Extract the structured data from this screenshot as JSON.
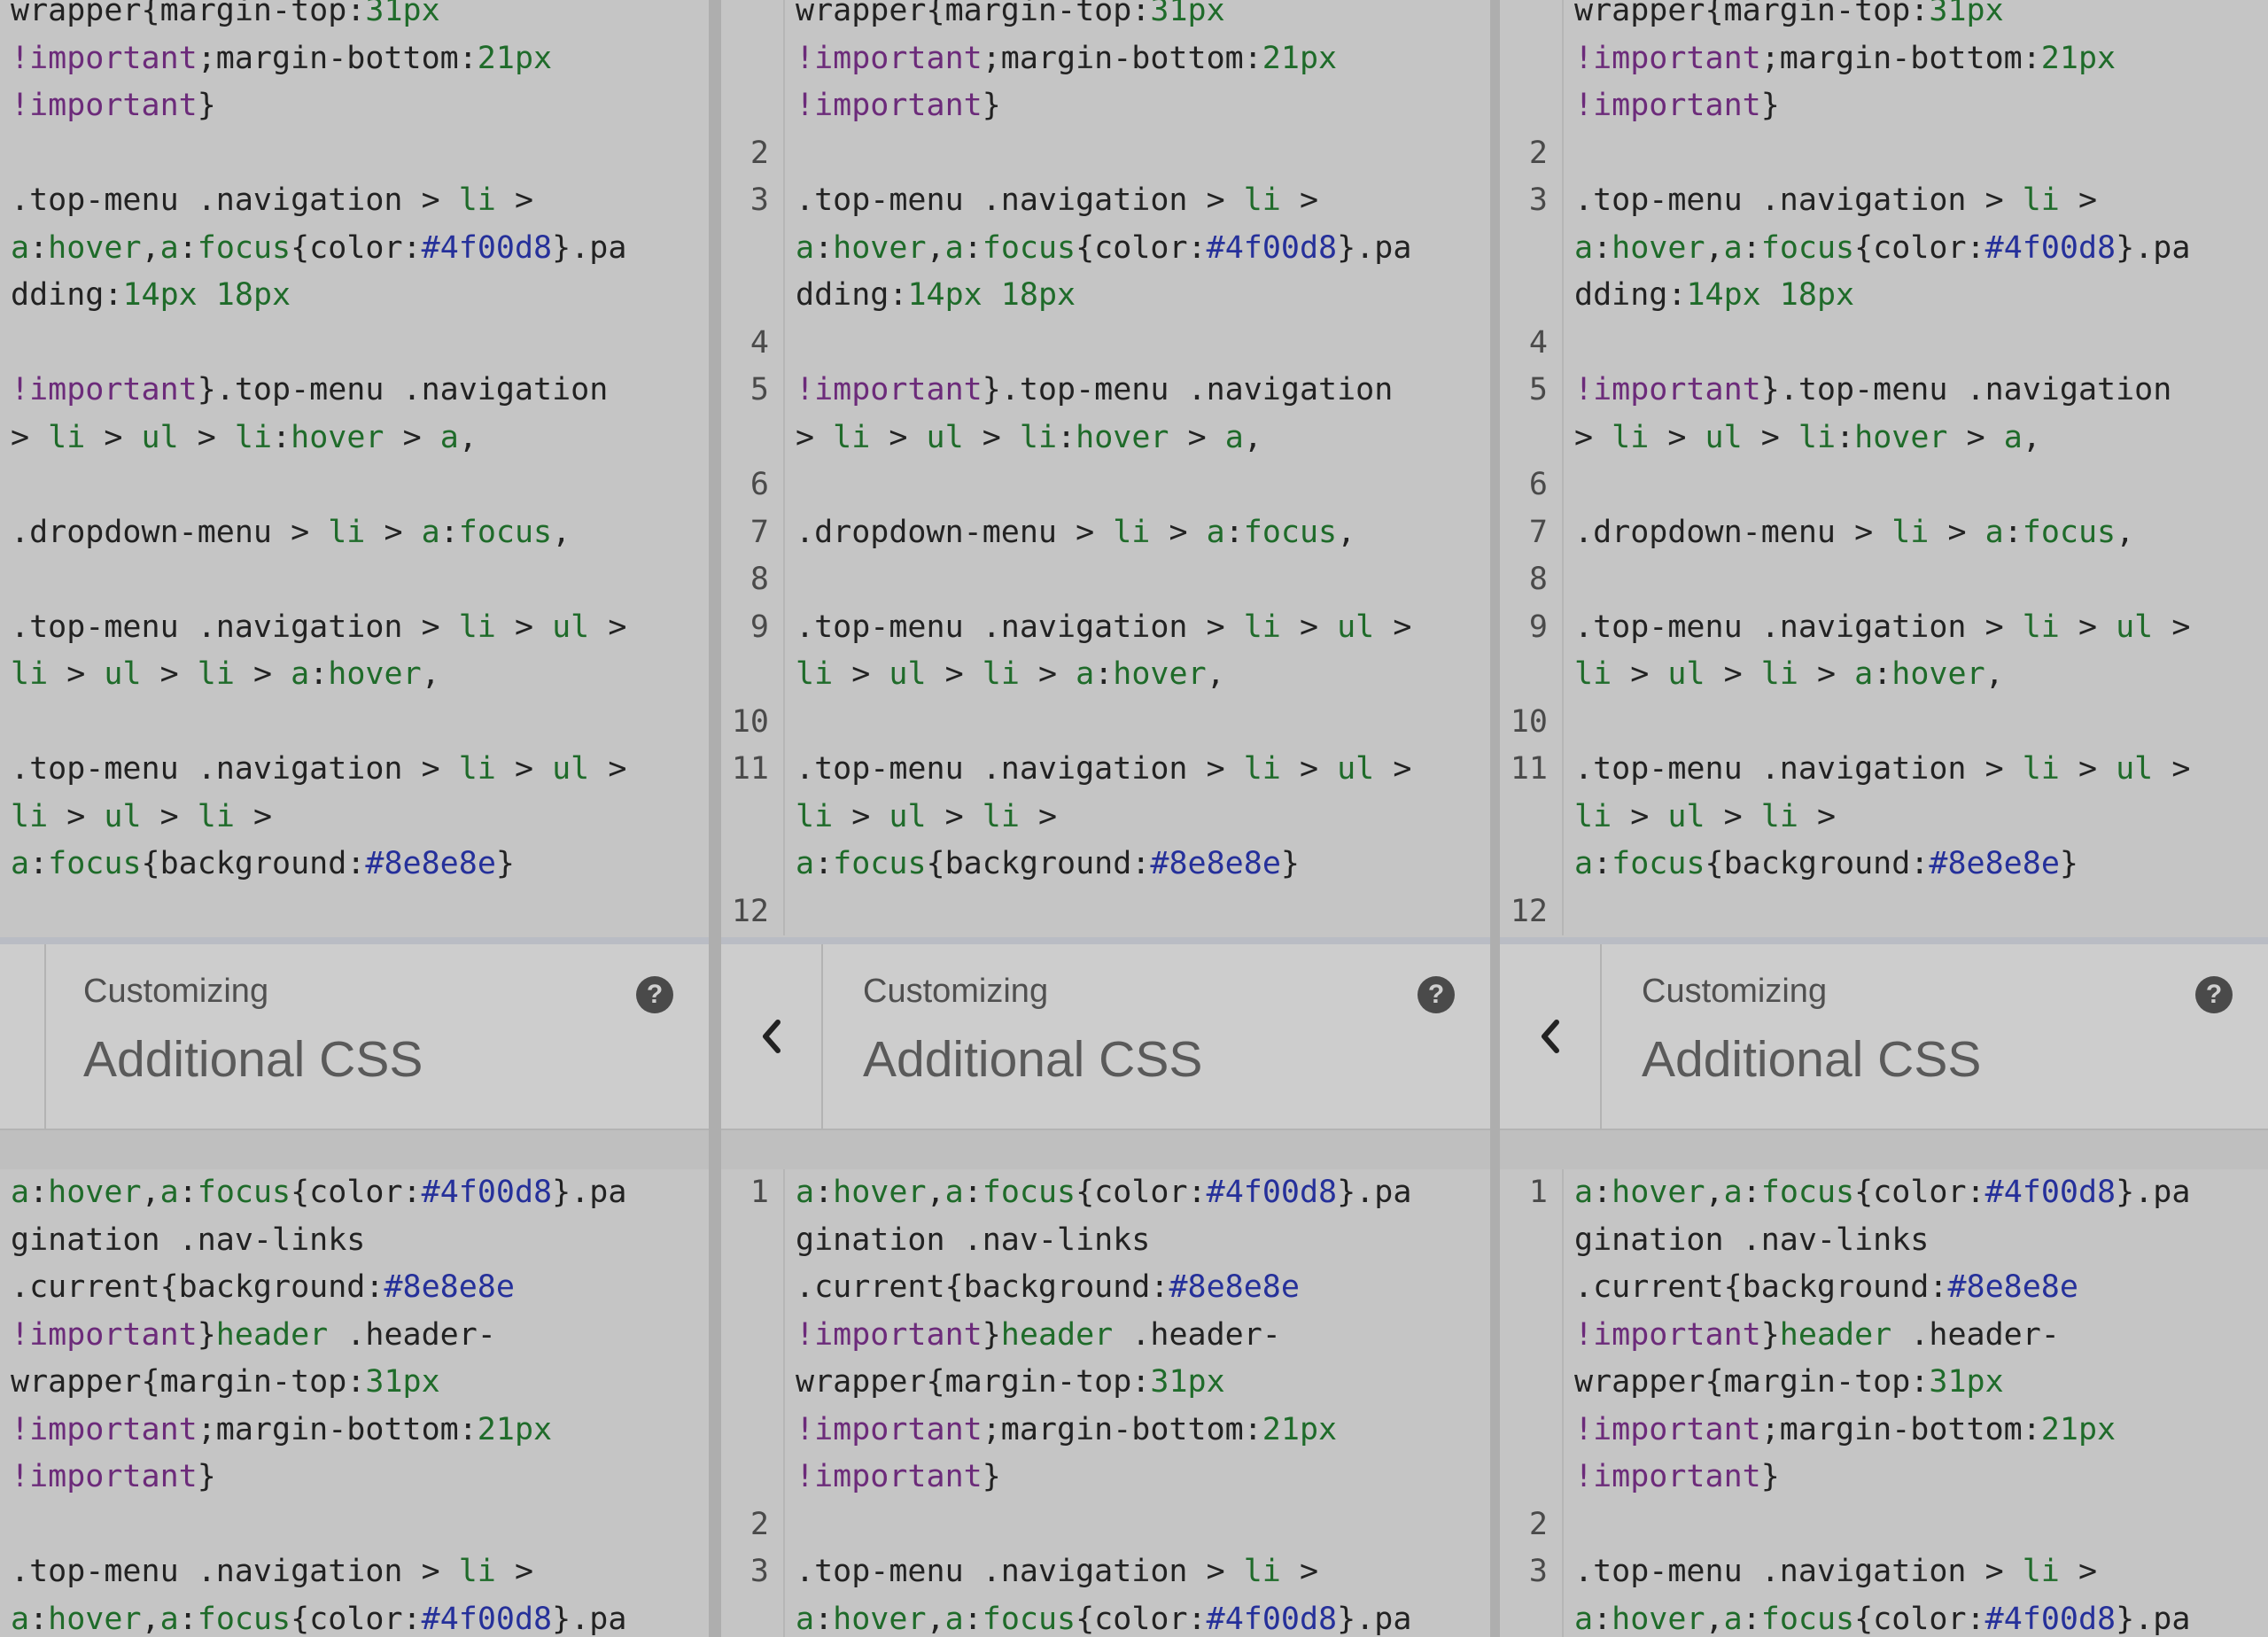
{
  "header": {
    "subtitle": "Customizing",
    "title": "Additional CSS",
    "help_glyph": "?",
    "back_icon": "chevron-left-icon",
    "help_icon": "question-circle-icon"
  },
  "code_top": {
    "lines": [
      {
        "num": "",
        "tokens": [
          [
            "t",
            "wrapper{margin-top:"
          ],
          [
            "n",
            "31px"
          ]
        ]
      },
      {
        "num": "",
        "tokens": [
          [
            "k",
            "!important"
          ],
          [
            "t",
            ";margin-bottom:"
          ],
          [
            "n",
            "21px"
          ]
        ]
      },
      {
        "num": "",
        "tokens": [
          [
            "k",
            "!important"
          ],
          [
            "t",
            "}"
          ]
        ]
      },
      {
        "num": "2",
        "tokens": []
      },
      {
        "num": "3",
        "tokens": [
          [
            "t",
            ".top-menu .navigation > "
          ],
          [
            "g",
            "li"
          ],
          [
            "t",
            " >"
          ]
        ]
      },
      {
        "num": "",
        "tokens": [
          [
            "g",
            "a"
          ],
          [
            "t",
            ":"
          ],
          [
            "g",
            "hover"
          ],
          [
            "t",
            ","
          ],
          [
            "g",
            "a"
          ],
          [
            "t",
            ":"
          ],
          [
            "g",
            "focus"
          ],
          [
            "t",
            "{color:"
          ],
          [
            "h",
            "#4f00d8"
          ],
          [
            "t",
            "}.pa"
          ]
        ]
      },
      {
        "num": "",
        "tokens": [
          [
            "t",
            "dding:"
          ],
          [
            "n",
            "14px 18px"
          ]
        ]
      },
      {
        "num": "4",
        "tokens": []
      },
      {
        "num": "5",
        "tokens": [
          [
            "k",
            "!important"
          ],
          [
            "t",
            "}.top-menu .navigation"
          ]
        ]
      },
      {
        "num": "",
        "tokens": [
          [
            "t",
            "> "
          ],
          [
            "g",
            "li"
          ],
          [
            "t",
            " > "
          ],
          [
            "g",
            "ul"
          ],
          [
            "t",
            " > "
          ],
          [
            "g",
            "li"
          ],
          [
            "t",
            ":"
          ],
          [
            "g",
            "hover"
          ],
          [
            "t",
            " > "
          ],
          [
            "g",
            "a"
          ],
          [
            "t",
            ","
          ]
        ]
      },
      {
        "num": "6",
        "tokens": []
      },
      {
        "num": "7",
        "tokens": [
          [
            "t",
            ".dropdown-menu > "
          ],
          [
            "g",
            "li"
          ],
          [
            "t",
            " > "
          ],
          [
            "g",
            "a"
          ],
          [
            "t",
            ":"
          ],
          [
            "g",
            "focus"
          ],
          [
            "t",
            ","
          ]
        ]
      },
      {
        "num": "8",
        "tokens": []
      },
      {
        "num": "9",
        "tokens": [
          [
            "t",
            ".top-menu .navigation > "
          ],
          [
            "g",
            "li"
          ],
          [
            "t",
            " > "
          ],
          [
            "g",
            "ul"
          ],
          [
            "t",
            " >"
          ]
        ]
      },
      {
        "num": "",
        "tokens": [
          [
            "g",
            "li"
          ],
          [
            "t",
            " > "
          ],
          [
            "g",
            "ul"
          ],
          [
            "t",
            " > "
          ],
          [
            "g",
            "li"
          ],
          [
            "t",
            " > "
          ],
          [
            "g",
            "a"
          ],
          [
            "t",
            ":"
          ],
          [
            "g",
            "hover"
          ],
          [
            "t",
            ","
          ]
        ]
      },
      {
        "num": "10",
        "tokens": []
      },
      {
        "num": "11",
        "tokens": [
          [
            "t",
            ".top-menu .navigation > "
          ],
          [
            "g",
            "li"
          ],
          [
            "t",
            " > "
          ],
          [
            "g",
            "ul"
          ],
          [
            "t",
            " >"
          ]
        ]
      },
      {
        "num": "",
        "tokens": [
          [
            "g",
            "li"
          ],
          [
            "t",
            " > "
          ],
          [
            "g",
            "ul"
          ],
          [
            "t",
            " > "
          ],
          [
            "g",
            "li"
          ],
          [
            "t",
            " >"
          ]
        ]
      },
      {
        "num": "",
        "tokens": [
          [
            "g",
            "a"
          ],
          [
            "t",
            ":"
          ],
          [
            "g",
            "focus"
          ],
          [
            "t",
            "{background:"
          ],
          [
            "h",
            "#8e8e8e"
          ],
          [
            "t",
            "}"
          ]
        ]
      },
      {
        "num": "12",
        "tokens": []
      }
    ]
  },
  "code_bottom": {
    "lines": [
      {
        "num": "1",
        "tokens": [
          [
            "g",
            "a"
          ],
          [
            "t",
            ":"
          ],
          [
            "g",
            "hover"
          ],
          [
            "t",
            ","
          ],
          [
            "g",
            "a"
          ],
          [
            "t",
            ":"
          ],
          [
            "g",
            "focus"
          ],
          [
            "t",
            "{color:"
          ],
          [
            "h",
            "#4f00d8"
          ],
          [
            "t",
            "}.pa"
          ]
        ]
      },
      {
        "num": "",
        "tokens": [
          [
            "t",
            "gination .nav-links"
          ]
        ]
      },
      {
        "num": "",
        "tokens": [
          [
            "t",
            ".current{background:"
          ],
          [
            "h",
            "#8e8e8e"
          ]
        ]
      },
      {
        "num": "",
        "tokens": [
          [
            "k",
            "!important"
          ],
          [
            "t",
            "}"
          ],
          [
            "g",
            "header"
          ],
          [
            "t",
            " .header-"
          ]
        ]
      },
      {
        "num": "",
        "tokens": [
          [
            "t",
            "wrapper{margin-top:"
          ],
          [
            "n",
            "31px"
          ]
        ]
      },
      {
        "num": "",
        "tokens": [
          [
            "k",
            "!important"
          ],
          [
            "t",
            ";margin-bottom:"
          ],
          [
            "n",
            "21px"
          ]
        ]
      },
      {
        "num": "",
        "tokens": [
          [
            "k",
            "!important"
          ],
          [
            "t",
            "}"
          ]
        ]
      },
      {
        "num": "2",
        "tokens": []
      },
      {
        "num": "3",
        "tokens": [
          [
            "t",
            ".top-menu .navigation > "
          ],
          [
            "g",
            "li"
          ],
          [
            "t",
            " >"
          ]
        ]
      },
      {
        "num": "",
        "tokens": [
          [
            "g",
            "a"
          ],
          [
            "t",
            ":"
          ],
          [
            "g",
            "hover"
          ],
          [
            "t",
            ","
          ],
          [
            "g",
            "a"
          ],
          [
            "t",
            ":"
          ],
          [
            "g",
            "focus"
          ],
          [
            "t",
            "{color:"
          ],
          [
            "h",
            "#4f00d8"
          ],
          [
            "t",
            "}.pa"
          ]
        ]
      }
    ]
  },
  "colors": {
    "keyword": "#6c2b7a",
    "tag": "#1f6b2a",
    "hex": "#25309a",
    "text": "#222222"
  }
}
